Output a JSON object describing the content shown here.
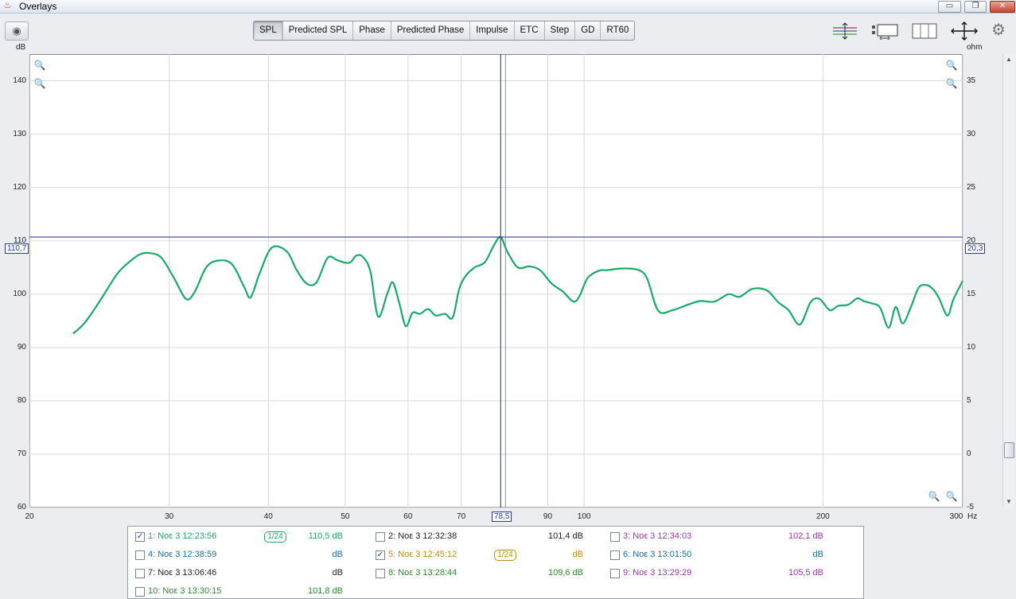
{
  "window": {
    "title": "Overlays",
    "app_icon": "java-cup-icon",
    "buttons": {
      "minimize": "▭",
      "restore": "❐",
      "close": "✕"
    }
  },
  "toolbar": {
    "tabs": [
      "SPL",
      "Predicted SPL",
      "Phase",
      "Predicted Phase",
      "Impulse",
      "ETC",
      "Step",
      "GD",
      "RT60"
    ],
    "active_tab": "SPL",
    "right_tools": [
      "graph-limits-icon",
      "legend-layout-icon",
      "columns-icon",
      "fit-arrows-icon",
      "gear-icon"
    ]
  },
  "axes": {
    "left_unit": "dB",
    "right_unit": "ohm",
    "x_unit": "Hz",
    "left_ticks": [
      "140",
      "130",
      "120",
      "110",
      "100",
      "90",
      "80",
      "70",
      "60"
    ],
    "right_ticks": [
      "35",
      "30",
      "25",
      "20",
      "15",
      "10",
      "5",
      "0",
      "-5"
    ],
    "x_ticks": [
      "20",
      "30",
      "40",
      "50",
      "60",
      "70",
      "90",
      "100",
      "200",
      "300"
    ]
  },
  "cursor": {
    "y_left_readout": "110,7",
    "y_right_readout": "20,3",
    "x_readout": "78,5"
  },
  "chart_data": {
    "type": "line",
    "x_scale": "log",
    "xlim": [
      20,
      300
    ],
    "ylim": [
      60,
      145
    ],
    "y2lim": [
      -5,
      37.5
    ],
    "grid": true,
    "cursor": {
      "freq_hz": 78.5,
      "db": 110.7
    },
    "series": [
      {
        "name": "1: Νοε 3 12:23:56",
        "color": "#1aaa6a",
        "x": [
          22.7,
          23.5,
          24.6,
          25.8,
          26.8,
          27.6,
          28.3,
          29.3,
          30.4,
          31.5,
          32.3,
          33.4,
          34.6,
          36.0,
          37.3,
          38.0,
          39.0,
          40.4,
          42.2,
          43.4,
          44.7,
          46.0,
          47.5,
          48.8,
          50.0,
          50.8,
          51.6,
          52.6,
          53.8,
          55.0,
          56.5,
          57.4,
          58.5,
          59.6,
          60.8,
          62.1,
          63.6,
          65.0,
          66.8,
          68.3,
          69.6,
          71.0,
          72.8,
          75.0,
          77.0,
          78.5,
          80.0,
          82.5,
          85.3,
          88.0,
          91.0,
          94.0,
          97.0,
          98.8,
          101.0,
          104.4,
          107.0,
          111.2,
          116.6,
          120.0,
          124.0,
          129.3,
          135.0,
          140.0,
          146.0,
          152.0,
          157.0,
          163.0,
          170.0,
          175.6,
          181.0,
          187.0,
          193.0,
          198.0,
          204.0,
          209.0,
          215.0,
          221.0,
          225.0,
          230.0,
          236.0,
          242.0,
          247.0,
          252.0,
          258.0,
          264.0,
          270.0,
          275.0,
          280.0,
          287.0,
          292.0,
          300.0
        ],
        "y": [
          92.6,
          94.7,
          99.0,
          103.8,
          106.2,
          107.5,
          107.7,
          106.9,
          103.1,
          99.1,
          100.4,
          105.0,
          106.3,
          105.6,
          101.3,
          99.4,
          103.9,
          108.7,
          108.0,
          104.6,
          102.0,
          102.2,
          106.8,
          106.4,
          105.9,
          106.0,
          107.2,
          107.0,
          104.2,
          95.8,
          100.1,
          102.2,
          98.3,
          94.0,
          96.5,
          96.3,
          97.2,
          96.0,
          96.3,
          95.6,
          101.0,
          103.5,
          105.0,
          106.0,
          109.2,
          110.7,
          108.0,
          105.0,
          105.2,
          104.5,
          102.0,
          100.5,
          98.6,
          99.8,
          103.0,
          104.4,
          104.5,
          104.8,
          104.6,
          103.0,
          96.9,
          97.0,
          98.0,
          98.7,
          98.6,
          100.0,
          99.5,
          101.0,
          100.7,
          98.5,
          97.0,
          94.3,
          98.5,
          99.1,
          97.0,
          97.8,
          98.0,
          99.2,
          98.7,
          98.3,
          97.5,
          93.7,
          97.6,
          94.5,
          97.5,
          101.2,
          101.7,
          101.0,
          99.3,
          96.0,
          99.0,
          102.5
        ]
      }
    ]
  },
  "legend": {
    "items": [
      {
        "name": "1: Νοε 3 12:23:56",
        "checked": true,
        "smoothing": "1/24",
        "value": "110,5 dB",
        "color": "#1aaa6a"
      },
      {
        "name": "2: Νοε 3 12:32:38",
        "checked": false,
        "smoothing": "",
        "value": "101,4 dB",
        "color": "#222222"
      },
      {
        "name": "3: Νοε 3 12:34:03",
        "checked": false,
        "smoothing": "",
        "value": "102,1 dB",
        "color": "#9b3aa8"
      },
      {
        "name": "4: Νοε 3 12:38:59",
        "checked": false,
        "smoothing": "",
        "value": "dB",
        "color": "#1a6fa0"
      },
      {
        "name": "5: Νοε 3 12:45:12",
        "checked": true,
        "smoothing": "1/24",
        "value": "dB",
        "color": "#b8900a"
      },
      {
        "name": "6: Νοε 3 13:01:50",
        "checked": false,
        "smoothing": "",
        "value": "dB",
        "color": "#1a6fa0"
      },
      {
        "name": "7: Νοε 3 13:06:46",
        "checked": false,
        "smoothing": "",
        "value": "dB",
        "color": "#222222"
      },
      {
        "name": "8: Νοε 3 13:28:44",
        "checked": false,
        "smoothing": "",
        "value": "109,6 dB",
        "color": "#2f8a2f"
      },
      {
        "name": "9: Νοε 3 13:29:29",
        "checked": false,
        "smoothing": "",
        "value": "105,5 dB",
        "color": "#9b3aa8"
      },
      {
        "name": "10: Νοε 3 13:30:15",
        "checked": false,
        "smoothing": "",
        "value": "101,8 dB",
        "color": "#2f8a2f"
      }
    ]
  }
}
